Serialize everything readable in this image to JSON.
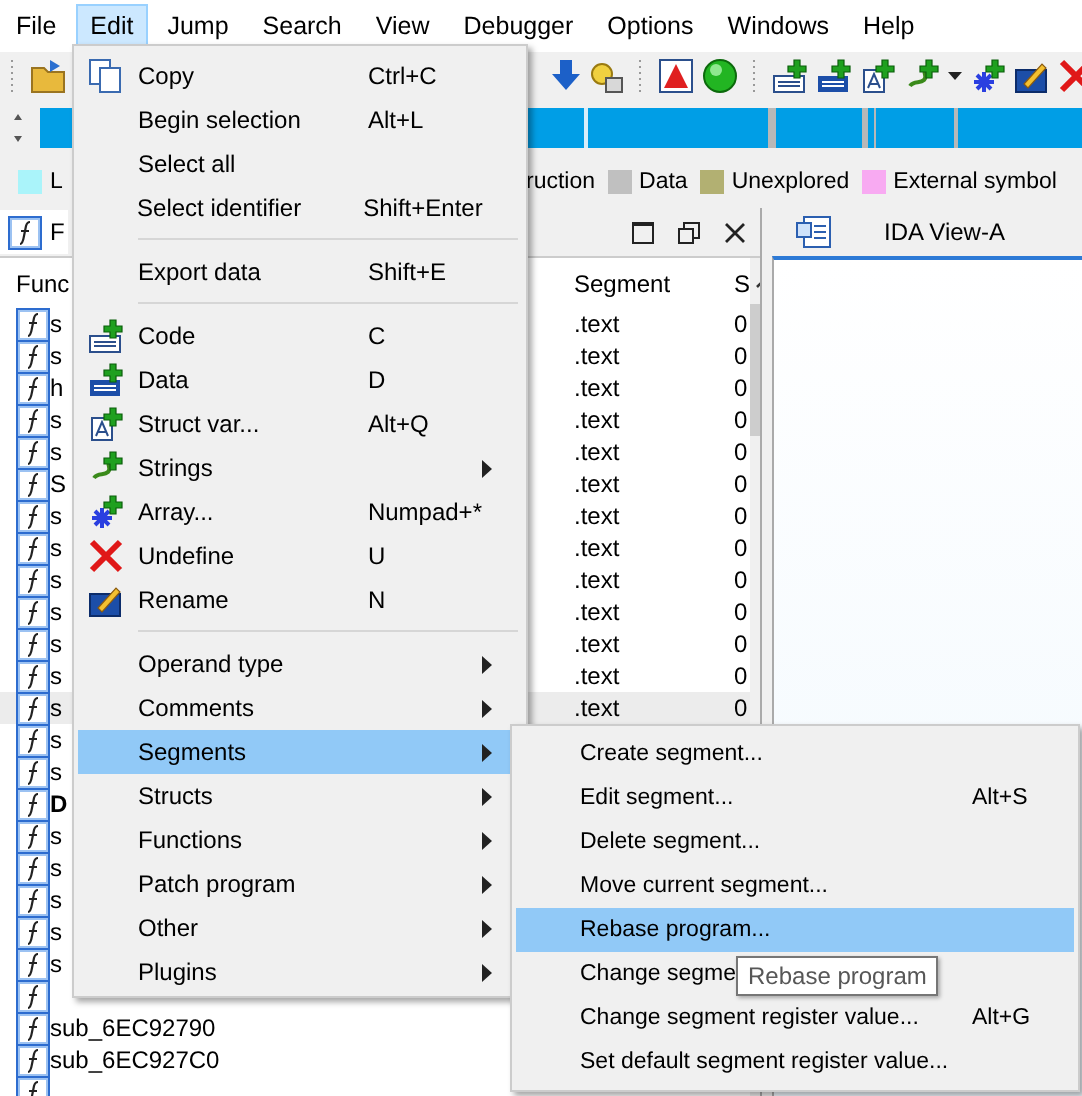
{
  "menu_bar": [
    {
      "label": "File",
      "selected": false
    },
    {
      "label": "Edit",
      "selected": true
    },
    {
      "label": "Jump",
      "selected": false
    },
    {
      "label": "Search",
      "selected": false
    },
    {
      "label": "View",
      "selected": false
    },
    {
      "label": "Debugger",
      "selected": false
    },
    {
      "label": "Options",
      "selected": false
    },
    {
      "label": "Windows",
      "selected": false
    },
    {
      "label": "Help",
      "selected": false
    }
  ],
  "legend": [
    {
      "label": "L",
      "color": "#aaf4fa"
    },
    {
      "label": "ruction"
    },
    {
      "label": "Data",
      "color": "#c0c0c0"
    },
    {
      "label": "Unexplored",
      "color": "#b2b072"
    },
    {
      "label": "External symbol",
      "color": "#f8aaf2"
    }
  ],
  "functions_panel": {
    "title": "F",
    "columns": [
      "Func",
      "Segment",
      "S"
    ],
    "rows": [
      {
        "name": "s",
        "segment": ".text",
        "column_3": "0",
        "selected": false,
        "bold": false
      },
      {
        "name": "s",
        "segment": ".text",
        "column_3": "0",
        "selected": false,
        "bold": false
      },
      {
        "name": "h",
        "segment": ".text",
        "column_3": "0",
        "selected": false,
        "bold": false
      },
      {
        "name": "s",
        "segment": ".text",
        "column_3": "0",
        "selected": false,
        "bold": false
      },
      {
        "name": "s",
        "segment": ".text",
        "column_3": "0",
        "selected": false,
        "bold": false
      },
      {
        "name": "S",
        "segment": ".text",
        "column_3": "0",
        "selected": false,
        "bold": false
      },
      {
        "name": "s",
        "segment": ".text",
        "column_3": "0",
        "selected": false,
        "bold": false
      },
      {
        "name": "s",
        "segment": ".text",
        "column_3": "0",
        "selected": false,
        "bold": false
      },
      {
        "name": "s",
        "segment": ".text",
        "column_3": "0",
        "selected": false,
        "bold": false
      },
      {
        "name": "s",
        "segment": ".text",
        "column_3": "0",
        "selected": false,
        "bold": false
      },
      {
        "name": "s",
        "segment": ".text",
        "column_3": "0",
        "selected": false,
        "bold": false
      },
      {
        "name": "s",
        "segment": ".text",
        "column_3": "0",
        "selected": false,
        "bold": false
      },
      {
        "name": "s",
        "segment": ".text",
        "column_3": "0",
        "selected": true,
        "bold": false
      },
      {
        "name": "s",
        "selected": false,
        "bold": false
      },
      {
        "name": "s",
        "selected": false,
        "bold": false
      },
      {
        "name": "D",
        "selected": false,
        "bold": true
      },
      {
        "name": "s",
        "selected": false,
        "bold": false
      },
      {
        "name": "s",
        "selected": false,
        "bold": false
      },
      {
        "name": "s",
        "selected": false,
        "bold": false
      },
      {
        "name": "s",
        "selected": false,
        "bold": false
      },
      {
        "name": "s",
        "selected": false,
        "bold": false
      },
      {
        "selected": false
      },
      {
        "name": "sub_6EC92790",
        "selected": false,
        "bold": false
      },
      {
        "name": "sub_6EC927C0",
        "selected": false,
        "bold": false
      },
      {
        "selected": false
      }
    ]
  },
  "ida_view": {
    "tab": "IDA View-A"
  },
  "edit_menu": {
    "items": [
      {
        "kind": "item",
        "label": "Copy",
        "shortcut": "Ctrl+C",
        "submenu": false,
        "selected": false
      },
      {
        "kind": "item",
        "label": "Begin selection",
        "shortcut": "Alt+L",
        "submenu": false,
        "selected": false
      },
      {
        "kind": "item",
        "label": "Select all",
        "submenu": false,
        "selected": false
      },
      {
        "kind": "item",
        "label": "Select identifier",
        "shortcut": "Shift+Enter",
        "submenu": false,
        "selected": false
      },
      {
        "kind": "separator"
      },
      {
        "kind": "item",
        "label": "Export data",
        "shortcut": "Shift+E",
        "submenu": false,
        "selected": false
      },
      {
        "kind": "separator"
      },
      {
        "kind": "item",
        "label": "Code",
        "shortcut": "C",
        "submenu": false,
        "selected": false
      },
      {
        "kind": "item",
        "label": "Data",
        "shortcut": "D",
        "submenu": false,
        "selected": false
      },
      {
        "kind": "item",
        "label": "Struct var...",
        "shortcut": "Alt+Q",
        "submenu": false,
        "selected": false
      },
      {
        "kind": "item",
        "label": "Strings",
        "submenu": true,
        "selected": false
      },
      {
        "kind": "item",
        "label": "Array...",
        "shortcut": "Numpad+*",
        "submenu": false,
        "selected": false
      },
      {
        "kind": "item",
        "label": "Undefine",
        "shortcut": "U",
        "submenu": false,
        "selected": false
      },
      {
        "kind": "item",
        "label": "Rename",
        "shortcut": "N",
        "submenu": false,
        "selected": false
      },
      {
        "kind": "separator"
      },
      {
        "kind": "item",
        "label": "Operand type",
        "submenu": true,
        "selected": false
      },
      {
        "kind": "item",
        "label": "Comments",
        "submenu": true,
        "selected": false
      },
      {
        "kind": "item",
        "label": "Segments",
        "submenu": true,
        "selected": true
      },
      {
        "kind": "item",
        "label": "Structs",
        "submenu": true,
        "selected": false
      },
      {
        "kind": "item",
        "label": "Functions",
        "submenu": true,
        "selected": false
      },
      {
        "kind": "item",
        "label": "Patch program",
        "submenu": true,
        "selected": false
      },
      {
        "kind": "item",
        "label": "Other",
        "submenu": true,
        "selected": false
      },
      {
        "kind": "item",
        "label": "Plugins",
        "submenu": true,
        "selected": false
      }
    ]
  },
  "segments_submenu": {
    "items": [
      {
        "label": "Create segment...",
        "selected": false
      },
      {
        "label": "Edit segment...",
        "shortcut": "Alt+S",
        "selected": false
      },
      {
        "label": "Delete segment...",
        "selected": false
      },
      {
        "label": "Move current segment...",
        "selected": false
      },
      {
        "label": "Rebase program...",
        "selected": true
      },
      {
        "label": "Change segme",
        "selected": false
      },
      {
        "label": "Change segment register value...",
        "shortcut": "Alt+G",
        "selected": false
      },
      {
        "label": "Set default segment register value...",
        "selected": false
      }
    ]
  },
  "tooltip": "Rebase program"
}
